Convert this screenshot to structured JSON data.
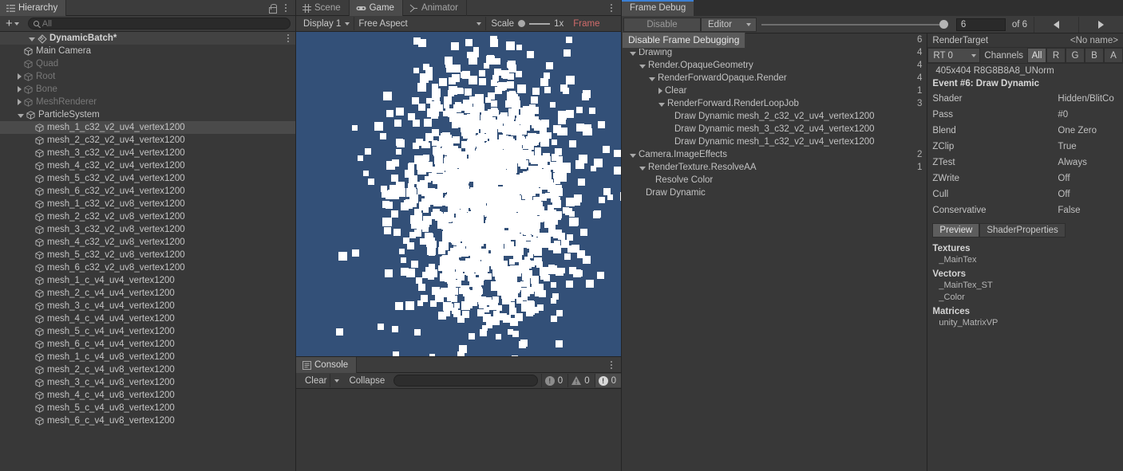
{
  "hierarchy": {
    "tab_label": "Hierarchy",
    "lock_icon": "lock-icon",
    "menu_icon": "kebab-menu-icon",
    "add_label": "+",
    "search_placeholder": "All",
    "search_value": "",
    "root": {
      "label": "DynamicBatch*",
      "modified": true
    },
    "items": [
      {
        "label": "Main Camera",
        "depth": 2,
        "expandable": false,
        "dim": false,
        "selected": false
      },
      {
        "label": "Quad",
        "depth": 2,
        "expandable": false,
        "dim": true,
        "selected": false
      },
      {
        "label": "Root",
        "depth": 2,
        "expandable": true,
        "dim": true,
        "selected": false
      },
      {
        "label": "Bone",
        "depth": 2,
        "expandable": true,
        "dim": true,
        "selected": false
      },
      {
        "label": "MeshRenderer",
        "depth": 2,
        "expandable": true,
        "dim": true,
        "selected": false
      },
      {
        "label": "ParticleSystem",
        "depth": 2,
        "expandable": true,
        "expanded": true,
        "dim": false,
        "selected": false
      },
      {
        "label": "mesh_1_c32_v2_uv4_vertex1200",
        "depth": 3,
        "expandable": false,
        "dim": false,
        "selected": true
      },
      {
        "label": "mesh_2_c32_v2_uv4_vertex1200",
        "depth": 3,
        "expandable": false,
        "dim": false,
        "selected": false
      },
      {
        "label": "mesh_3_c32_v2_uv4_vertex1200",
        "depth": 3,
        "expandable": false,
        "dim": false,
        "selected": false
      },
      {
        "label": "mesh_4_c32_v2_uv4_vertex1200",
        "depth": 3,
        "expandable": false,
        "dim": false,
        "selected": false
      },
      {
        "label": "mesh_5_c32_v2_uv4_vertex1200",
        "depth": 3,
        "expandable": false,
        "dim": false,
        "selected": false
      },
      {
        "label": "mesh_6_c32_v2_uv4_vertex1200",
        "depth": 3,
        "expandable": false,
        "dim": false,
        "selected": false
      },
      {
        "label": "mesh_1_c32_v2_uv8_vertex1200",
        "depth": 3,
        "expandable": false,
        "dim": false,
        "selected": false
      },
      {
        "label": "mesh_2_c32_v2_uv8_vertex1200",
        "depth": 3,
        "expandable": false,
        "dim": false,
        "selected": false
      },
      {
        "label": "mesh_3_c32_v2_uv8_vertex1200",
        "depth": 3,
        "expandable": false,
        "dim": false,
        "selected": false
      },
      {
        "label": "mesh_4_c32_v2_uv8_vertex1200",
        "depth": 3,
        "expandable": false,
        "dim": false,
        "selected": false
      },
      {
        "label": "mesh_5_c32_v2_uv8_vertex1200",
        "depth": 3,
        "expandable": false,
        "dim": false,
        "selected": false
      },
      {
        "label": "mesh_6_c32_v2_uv8_vertex1200",
        "depth": 3,
        "expandable": false,
        "dim": false,
        "selected": false
      },
      {
        "label": "mesh_1_c_v4_uv4_vertex1200",
        "depth": 3,
        "expandable": false,
        "dim": false,
        "selected": false
      },
      {
        "label": "mesh_2_c_v4_uv4_vertex1200",
        "depth": 3,
        "expandable": false,
        "dim": false,
        "selected": false
      },
      {
        "label": "mesh_3_c_v4_uv4_vertex1200",
        "depth": 3,
        "expandable": false,
        "dim": false,
        "selected": false
      },
      {
        "label": "mesh_4_c_v4_uv4_vertex1200",
        "depth": 3,
        "expandable": false,
        "dim": false,
        "selected": false
      },
      {
        "label": "mesh_5_c_v4_uv4_vertex1200",
        "depth": 3,
        "expandable": false,
        "dim": false,
        "selected": false
      },
      {
        "label": "mesh_6_c_v4_uv4_vertex1200",
        "depth": 3,
        "expandable": false,
        "dim": false,
        "selected": false
      },
      {
        "label": "mesh_1_c_v4_uv8_vertex1200",
        "depth": 3,
        "expandable": false,
        "dim": false,
        "selected": false
      },
      {
        "label": "mesh_2_c_v4_uv8_vertex1200",
        "depth": 3,
        "expandable": false,
        "dim": false,
        "selected": false
      },
      {
        "label": "mesh_3_c_v4_uv8_vertex1200",
        "depth": 3,
        "expandable": false,
        "dim": false,
        "selected": false
      },
      {
        "label": "mesh_4_c_v4_uv8_vertex1200",
        "depth": 3,
        "expandable": false,
        "dim": false,
        "selected": false
      },
      {
        "label": "mesh_5_c_v4_uv8_vertex1200",
        "depth": 3,
        "expandable": false,
        "dim": false,
        "selected": false
      },
      {
        "label": "mesh_6_c_v4_uv8_vertex1200",
        "depth": 3,
        "expandable": false,
        "dim": false,
        "selected": false
      }
    ]
  },
  "gameview": {
    "tabs": [
      {
        "label": "Scene",
        "icon": "grid-icon",
        "active": false
      },
      {
        "label": "Game",
        "icon": "gamepad-icon",
        "active": true
      },
      {
        "label": "Animator",
        "icon": "animator-icon",
        "active": false
      }
    ],
    "menu_icon": "kebab-menu-icon",
    "display": "Display 1",
    "aspect": "Free Aspect",
    "scale_label": "Scale",
    "scale_value": "1x",
    "frame_label": "Frame ",
    "background_color": "#335078",
    "particle_color": "#ffffff"
  },
  "console": {
    "tab_label": "Console",
    "tab_icon": "console-icon",
    "menu_icon": "kebab-menu-icon",
    "clear_label": "Clear",
    "clear_dropdown_icon": "chevron-down-icon",
    "collapse_label": "Collapse",
    "search_value": "",
    "counts": [
      {
        "type": "info",
        "value": "0",
        "active": false
      },
      {
        "type": "warning",
        "value": "0",
        "active": false
      },
      {
        "type": "error",
        "value": "0",
        "active": true
      }
    ]
  },
  "framedebug": {
    "tab_label": "Frame Debug",
    "disable_label": "Disable",
    "editor_label": "Editor",
    "dropdown_icon": "chevron-down-icon",
    "frame_value": "6",
    "frame_total": "of 6",
    "prev_icon": "arrow-left-icon",
    "next_icon": "arrow-right-icon",
    "tooltip": "Disable Frame Debugging",
    "tree": [
      {
        "label": "Drawing",
        "depth": 1,
        "tri": "open",
        "count": "4"
      },
      {
        "label": "Render.OpaqueGeometry",
        "depth": 2,
        "tri": "open",
        "count": "4"
      },
      {
        "label": "RenderForwardOpaque.Render",
        "depth": 3,
        "tri": "open",
        "count": "4"
      },
      {
        "label": "Clear",
        "depth": 4,
        "tri": "closed",
        "count": "1"
      },
      {
        "label": "RenderForward.RenderLoopJob",
        "depth": 4,
        "tri": "open",
        "count": "3"
      },
      {
        "label": "Draw Dynamic mesh_2_c32_v2_uv4_vertex1200",
        "depth": 5,
        "tri": "none",
        "count": ""
      },
      {
        "label": "Draw Dynamic mesh_3_c32_v2_uv4_vertex1200",
        "depth": 5,
        "tri": "none",
        "count": ""
      },
      {
        "label": "Draw Dynamic mesh_1_c32_v2_uv4_vertex1200",
        "depth": 5,
        "tri": "none",
        "count": ""
      },
      {
        "label": "Camera.ImageEffects",
        "depth": 1,
        "tri": "open",
        "count": "2"
      },
      {
        "label": "RenderTexture.ResolveAA",
        "depth": 2,
        "tri": "open",
        "count": "1"
      },
      {
        "label": "Resolve Color",
        "depth": 3,
        "tri": "none",
        "count": ""
      },
      {
        "label": "Draw Dynamic",
        "depth": 2,
        "tri": "none",
        "count": ""
      }
    ],
    "top_count": "6",
    "inspector": {
      "rendertarget_label": "RenderTarget",
      "rendertarget_value": "<No name>",
      "rt_select": "RT 0",
      "channels_label": "Channels",
      "channels": [
        {
          "label": "All",
          "active": true
        },
        {
          "label": "R",
          "active": false
        },
        {
          "label": "G",
          "active": false
        },
        {
          "label": "B",
          "active": false
        },
        {
          "label": "A",
          "active": false
        }
      ],
      "format_info": "405x404 R8G8B8A8_UNorm",
      "event_title": "Event #6: Draw Dynamic",
      "properties": [
        {
          "key": "Shader",
          "value": "Hidden/BlitCo"
        },
        {
          "key": "Pass",
          "value": "#0"
        },
        {
          "key": "Blend",
          "value": "One Zero"
        },
        {
          "key": "ZClip",
          "value": "True"
        },
        {
          "key": "ZTest",
          "value": "Always"
        },
        {
          "key": "ZWrite",
          "value": "Off"
        },
        {
          "key": "Cull",
          "value": "Off"
        },
        {
          "key": "Conservative",
          "value": "False"
        }
      ],
      "tabs": [
        {
          "label": "Preview",
          "active": true
        },
        {
          "label": "ShaderProperties",
          "active": false
        }
      ],
      "sections": [
        {
          "title": "Textures",
          "items": [
            "_MainTex"
          ]
        },
        {
          "title": "Vectors",
          "items": [
            "_MainTex_ST",
            "_Color"
          ]
        },
        {
          "title": "Matrices",
          "items": [
            "unity_MatrixVP"
          ]
        }
      ]
    }
  }
}
